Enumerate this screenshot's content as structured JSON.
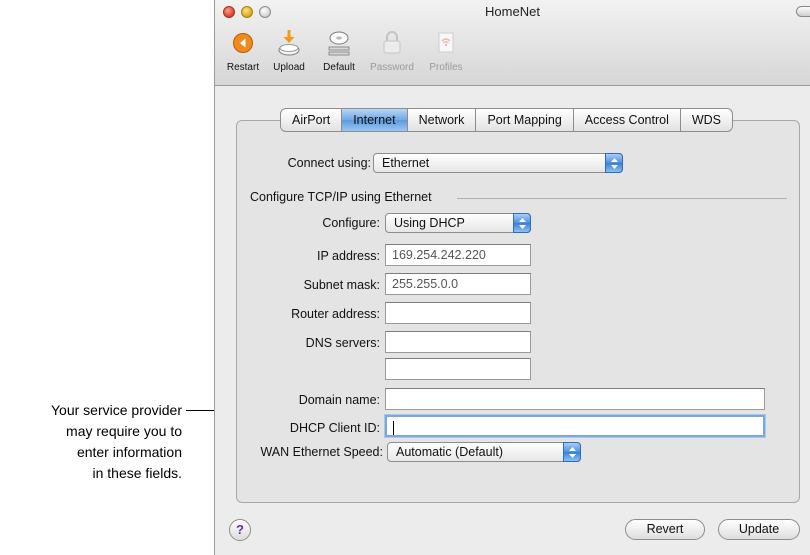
{
  "callout": {
    "lines": [
      "Your service provider",
      "may require you to",
      "enter information",
      "in these fields."
    ]
  },
  "window": {
    "title": "HomeNet"
  },
  "toolbar": {
    "items": [
      {
        "label": "Restart",
        "icon": "restart-icon",
        "enabled": true
      },
      {
        "label": "Upload",
        "icon": "upload-icon",
        "enabled": true
      },
      {
        "label": "Default",
        "icon": "default-icon",
        "enabled": true
      },
      {
        "label": "Password",
        "icon": "lock-icon",
        "enabled": false
      },
      {
        "label": "Profiles",
        "icon": "profiles-icon",
        "enabled": false
      }
    ]
  },
  "tabs": [
    {
      "label": "AirPort",
      "selected": false
    },
    {
      "label": "Internet",
      "selected": true
    },
    {
      "label": "Network",
      "selected": false
    },
    {
      "label": "Port Mapping",
      "selected": false
    },
    {
      "label": "Access Control",
      "selected": false
    },
    {
      "label": "WDS",
      "selected": false
    }
  ],
  "form": {
    "connect_using": {
      "label": "Connect using:",
      "value": "Ethernet"
    },
    "group_title": "Configure TCP/IP using Ethernet",
    "configure": {
      "label": "Configure:",
      "value": "Using DHCP"
    },
    "ip_address": {
      "label": "IP address:",
      "value": "169.254.242.220"
    },
    "subnet_mask": {
      "label": "Subnet mask:",
      "value": "255.255.0.0"
    },
    "router_address": {
      "label": "Router address:",
      "value": ""
    },
    "dns_servers": {
      "label": "DNS servers:",
      "value1": "",
      "value2": ""
    },
    "domain_name": {
      "label": "Domain name:",
      "value": ""
    },
    "dhcp_client_id": {
      "label": "DHCP Client ID:",
      "value": ""
    },
    "wan_speed": {
      "label": "WAN Ethernet Speed:",
      "value": "Automatic (Default)"
    }
  },
  "buttons": {
    "help": "?",
    "revert": "Revert",
    "update": "Update"
  },
  "colors": {
    "accent": "#5b9ae0",
    "restart_orange": "#f08a1c",
    "upload_orange": "#f39a1a"
  }
}
